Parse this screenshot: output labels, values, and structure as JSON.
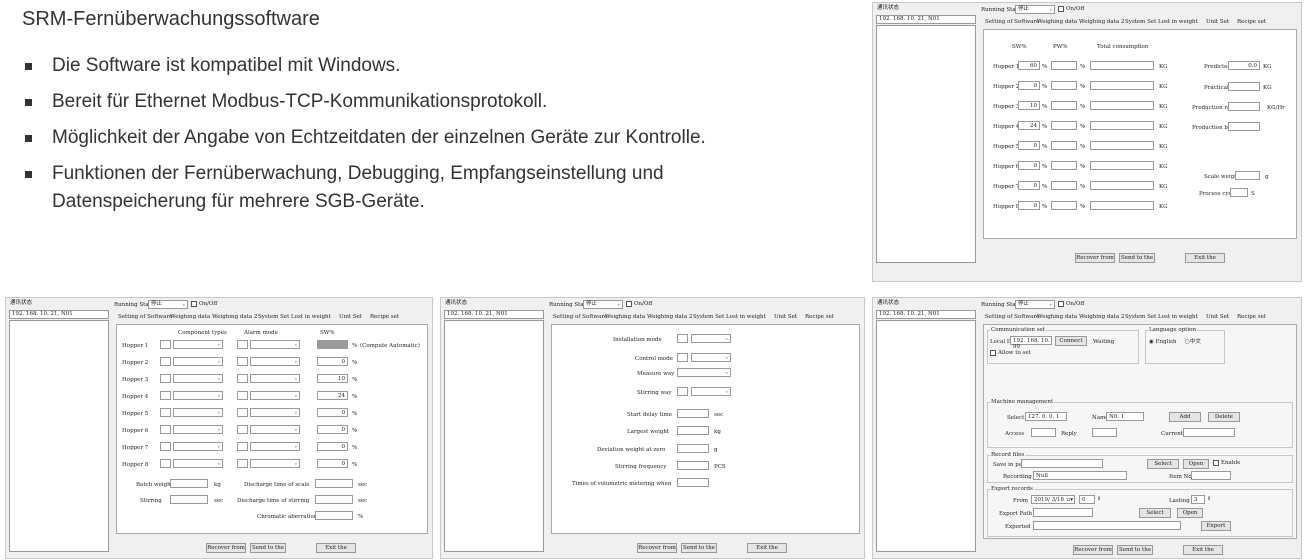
{
  "heading": "SRM-Fernüberwachungssoftware",
  "bullets": [
    "Die Software ist kompatibel mit Windows.",
    "Bereit für Ethernet Modbus-TCP-Kommunikationsprotokoll.",
    "Möglichkeit der Angabe von Echtzeitdaten der einzelnen Geräte zur Kontrolle.",
    "Funktionen der Fernüberwachung, Debugging, Empfangseinstellung und Datenspeicherung für mehrere SGB-Geräte."
  ],
  "app": {
    "corner_label": "通讯状态",
    "ip": "192. 168. 10. 21, N01",
    "running_status_label": "Running Status",
    "status_value": "停止",
    "onoff_label": "On/Off",
    "tabs": [
      "Setting of Software",
      "Weighing data",
      "Weighing data 2",
      "System Set",
      "Lost in weight",
      "Unit Set",
      "Recipe set"
    ],
    "buttons": {
      "recover": "Recover from",
      "send": "Send to the",
      "exit": "Exit the"
    }
  },
  "win1": {
    "col_sw": "SW%",
    "col_pw": "PW%",
    "col_total": "Total consumption",
    "unit_pct": "%",
    "unit_kg": "KG",
    "hoppers": [
      {
        "label": "Hopper 1",
        "sw": "60"
      },
      {
        "label": "Hopper 2",
        "sw": "0"
      },
      {
        "label": "Hopper 3",
        "sw": "10"
      },
      {
        "label": "Hopper 4",
        "sw": "24"
      },
      {
        "label": "Hopper 5",
        "sw": "0"
      },
      {
        "label": "Hopper 6",
        "sw": "0"
      },
      {
        "label": "Hopper 7",
        "sw": "0"
      },
      {
        "label": "Hopper 8",
        "sw": "0"
      }
    ],
    "predicted_label": "Predicted",
    "predicted_value": "0.0",
    "predicted_unit": "KG",
    "practical_label": "Practical",
    "practical_unit": "KG",
    "prod_rate_label": "Production rate",
    "prod_rate_unit": "KG/Hr",
    "prod_batch_label": "Production batch",
    "scale_weight_label": "Scale weight",
    "scale_weight_unit": "g",
    "process_cycle_label": "Process cycle",
    "process_cycle_unit": "S"
  },
  "win2": {
    "col_component": "Component types",
    "col_alarm": "Alarm mode",
    "col_sw": "SW%",
    "unit_pct": "%",
    "compute_note": "(Compute Automatic)",
    "hoppers": [
      {
        "label": "Hopper 1",
        "sw": ""
      },
      {
        "label": "Hopper 2",
        "sw": "0"
      },
      {
        "label": "Hopper 3",
        "sw": "10"
      },
      {
        "label": "Hopper 4",
        "sw": "24"
      },
      {
        "label": "Hopper 5",
        "sw": "0"
      },
      {
        "label": "Hopper 6",
        "sw": "0"
      },
      {
        "label": "Hopper 7",
        "sw": "0"
      },
      {
        "label": "Hopper 8",
        "sw": "0"
      }
    ],
    "batch_weight_label": "Batch weight",
    "batch_weight_unit": "kg",
    "stirring_label": "Stirring",
    "stirring_unit": "sec",
    "discharge_scale_label": "Discharge time of scale",
    "discharge_scale_unit": "sec",
    "discharge_stir_label": "Discharge time of stirring",
    "discharge_stir_unit": "sec",
    "chromatic_label": "Chromatic aberration",
    "chromatic_unit": "%"
  },
  "win3": {
    "installation_mode": "Installation mode",
    "control_mode": "Control mode",
    "measure_way": "Measure way",
    "stirring_way": "Stirring way",
    "start_delay": "Start delay time",
    "start_delay_unit": "sec",
    "largest_weight": "Largest weight",
    "largest_weight_unit": "kg",
    "deviation": "Deviation weight at zero",
    "deviation_unit": "g",
    "stirring_freq": "Stirring frequency",
    "stirring_freq_unit": "PCS",
    "volumetric": "Times of volumetric metering when"
  },
  "win4": {
    "comm_title": "Communication set",
    "local_ip_label": "Local IP",
    "local_ip": "192. 168. 10. 99",
    "connect": "Connect",
    "waiting": "Waiting",
    "allow_set": "Allow to set",
    "lang_title": "Language option",
    "lang_english": "English",
    "lang_chinese": "中文",
    "machine_title": "Machine management",
    "select_label": "Select",
    "select_value": "127. 0. 0. 1",
    "name_label": "Name",
    "name_value": "N0. 1",
    "add": "Add",
    "delete": "Delete",
    "access_label": "Access",
    "reply_label": "Reply",
    "current_label": "Current",
    "record_title": "Record files",
    "save_path_label": "Save in path",
    "select_btn": "Select",
    "open_btn": "Open",
    "enable": "Enable",
    "recording_label": "Recording",
    "recording_value": "Null",
    "item_no_label": "Item No",
    "export_title": "Export records",
    "from_label": "From",
    "from_date": "2019/ 3/18",
    "from_hour": "0",
    "lasting_label": "Lasting",
    "lasting_value": "3",
    "export_path_label": "Export Path",
    "exported_label": "Exported",
    "export_btn": "Export"
  }
}
